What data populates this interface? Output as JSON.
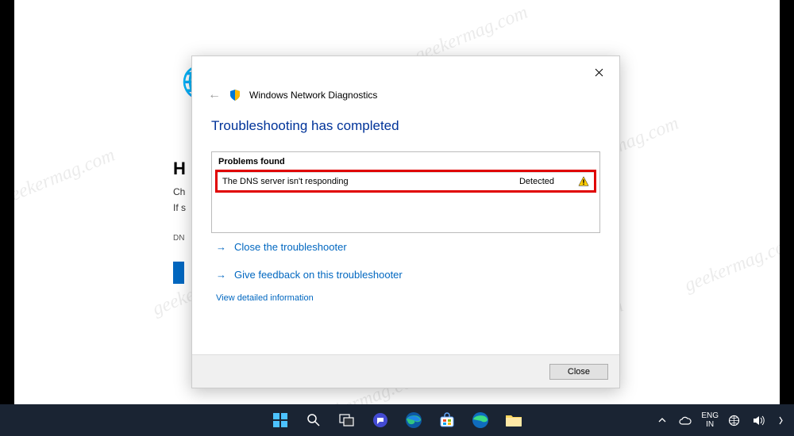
{
  "watermark": "geekermag.com",
  "background": {
    "heading_fragment": "H",
    "line1_fragment": "Ch",
    "line2_fragment": "If s",
    "dns_fragment": "DN"
  },
  "dialog": {
    "title": "Windows Network Diagnostics",
    "heading": "Troubleshooting has completed",
    "problems_label": "Problems found",
    "problem": {
      "text": "The DNS server isn't responding",
      "status": "Detected"
    },
    "actions": {
      "close_troubleshooter": "Close the troubleshooter",
      "give_feedback": "Give feedback on this troubleshooter"
    },
    "detail_link": "View detailed information",
    "close_button": "Close"
  },
  "taskbar": {
    "language": {
      "line1": "ENG",
      "line2": "IN"
    }
  }
}
